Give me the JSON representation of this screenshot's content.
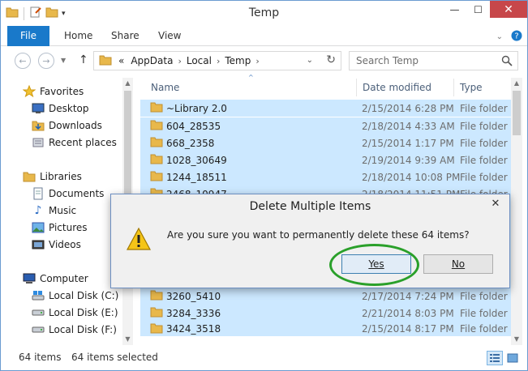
{
  "window": {
    "title": "Temp"
  },
  "ribbon": {
    "tabs": [
      {
        "label": "File"
      },
      {
        "label": "Home"
      },
      {
        "label": "Share"
      },
      {
        "label": "View"
      }
    ]
  },
  "address": {
    "prefix": "«",
    "crumbs": [
      "AppData",
      "Local",
      "Temp"
    ],
    "search_placeholder": "Search Temp"
  },
  "navpane": {
    "favorites": {
      "label": "Favorites",
      "items": [
        "Desktop",
        "Downloads",
        "Recent places"
      ]
    },
    "libraries": {
      "label": "Libraries",
      "items": [
        "Documents",
        "Music",
        "Pictures",
        "Videos"
      ]
    },
    "computer": {
      "label": "Computer",
      "items": [
        "Local Disk (C:)",
        "Local Disk (E:)",
        "Local Disk (F:)"
      ]
    }
  },
  "filelist": {
    "columns": {
      "name": "Name",
      "date": "Date modified",
      "type": "Type"
    },
    "rows": [
      {
        "name": "~Library 2.0",
        "date": "2/15/2014 6:28 PM",
        "type": "File folder"
      },
      {
        "name": "604_28535",
        "date": "2/18/2014 4:33 AM",
        "type": "File folder"
      },
      {
        "name": "668_2358",
        "date": "2/15/2014 1:17 PM",
        "type": "File folder"
      },
      {
        "name": "1028_30649",
        "date": "2/19/2014 9:39 AM",
        "type": "File folder"
      },
      {
        "name": "1244_18511",
        "date": "2/18/2014 10:08 PM",
        "type": "File folder"
      },
      {
        "name": "2468_10947",
        "date": "2/18/2014 11:51 PM",
        "type": "File folder"
      },
      {
        "name": "3260_5410",
        "date": "2/17/2014 7:24 PM",
        "type": "File folder"
      },
      {
        "name": "3284_3336",
        "date": "2/21/2014 8:03 PM",
        "type": "File folder"
      },
      {
        "name": "3424_3518",
        "date": "2/15/2014 8:17 PM",
        "type": "File folder"
      }
    ]
  },
  "status": {
    "count": "64 items",
    "selected": "64 items selected"
  },
  "dialog": {
    "title": "Delete Multiple Items",
    "message": "Are you sure you want to permanently delete these 64 items?",
    "yes_label": "Yes",
    "no_label": "No"
  },
  "colors": {
    "accent": "#1979ca",
    "selection": "#cce8ff",
    "highlight_ring": "#2aa02a",
    "close_button": "#c7474a"
  }
}
